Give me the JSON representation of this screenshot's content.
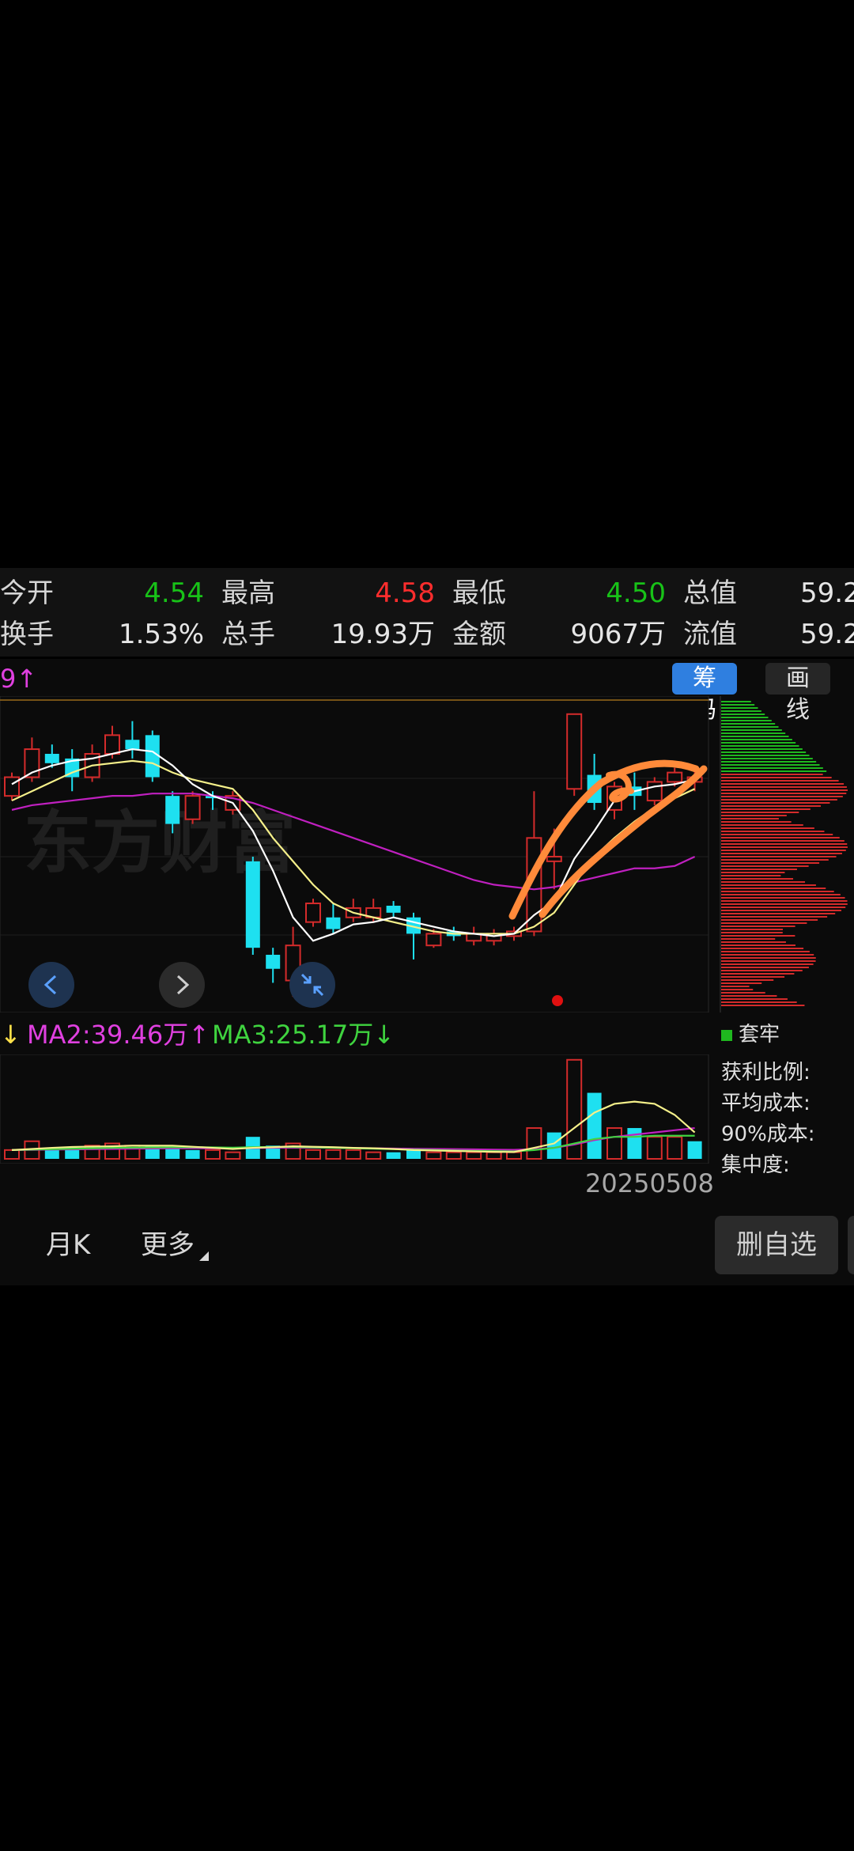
{
  "stats": {
    "row1": [
      {
        "label": "今开",
        "value": "4.54",
        "color": "green"
      },
      {
        "label": "最高",
        "value": "4.58",
        "color": "red"
      },
      {
        "label": "最低",
        "value": "4.50",
        "color": "green"
      },
      {
        "label": "总值",
        "value": "59.2"
      }
    ],
    "row2": [
      {
        "label": "换手",
        "value": "1.53%"
      },
      {
        "label": "总手",
        "value": "19.93万"
      },
      {
        "label": "金额",
        "value": "9067万"
      },
      {
        "label": "流值",
        "value": "59.2"
      }
    ]
  },
  "toolbar": {
    "ma_partial": "9↑",
    "chips_button": "筹码",
    "draw_button": "画线"
  },
  "watermark": "东方财富",
  "ma_legend": {
    "ma1_arrow": "↓",
    "ma2": "MA2:39.46万↑",
    "ma3": "MA3:25.17万↓"
  },
  "chip_panel": {
    "legend": "套牢",
    "profit_ratio": "获利比例:",
    "avg_cost": "平均成本:",
    "cost90": "90%成本:",
    "concentration": "集中度:"
  },
  "date": "20250508",
  "bottom": {
    "monthk": "月K",
    "more": "更多",
    "remove_watchlist": "删自选"
  },
  "colors": {
    "up": "#d42b2b",
    "down": "#1ee0f0",
    "ma_white": "#ffffff",
    "ma_yellow": "#f5f08a",
    "ma_magenta": "#c020c0",
    "annotation": "#ff8a3a"
  },
  "chart_data": {
    "type": "candlestick",
    "candles": [
      {
        "o": 4.2,
        "c": 4.28,
        "h": 4.3,
        "l": 4.18
      },
      {
        "o": 4.28,
        "c": 4.4,
        "h": 4.45,
        "l": 4.26
      },
      {
        "o": 4.38,
        "c": 4.34,
        "h": 4.42,
        "l": 4.32
      },
      {
        "o": 4.36,
        "c": 4.28,
        "h": 4.4,
        "l": 4.22
      },
      {
        "o": 4.28,
        "c": 4.38,
        "h": 4.42,
        "l": 4.26
      },
      {
        "o": 4.38,
        "c": 4.46,
        "h": 4.5,
        "l": 4.36
      },
      {
        "o": 4.44,
        "c": 4.4,
        "h": 4.52,
        "l": 4.36
      },
      {
        "o": 4.46,
        "c": 4.28,
        "h": 4.48,
        "l": 4.26
      },
      {
        "o": 4.2,
        "c": 4.08,
        "h": 4.22,
        "l": 4.04
      },
      {
        "o": 4.1,
        "c": 4.2,
        "h": 4.22,
        "l": 4.08
      },
      {
        "o": 4.2,
        "c": 4.19,
        "h": 4.22,
        "l": 4.14
      },
      {
        "o": 4.14,
        "c": 4.2,
        "h": 4.22,
        "l": 4.12
      },
      {
        "o": 3.92,
        "c": 3.55,
        "h": 3.94,
        "l": 3.52
      },
      {
        "o": 3.52,
        "c": 3.46,
        "h": 3.55,
        "l": 3.4
      },
      {
        "o": 3.41,
        "c": 3.56,
        "h": 3.64,
        "l": 3.34
      },
      {
        "o": 3.66,
        "c": 3.74,
        "h": 3.76,
        "l": 3.64
      },
      {
        "o": 3.68,
        "c": 3.63,
        "h": 3.74,
        "l": 3.61
      },
      {
        "o": 3.68,
        "c": 3.72,
        "h": 3.76,
        "l": 3.66
      },
      {
        "o": 3.68,
        "c": 3.72,
        "h": 3.76,
        "l": 3.66
      },
      {
        "o": 3.73,
        "c": 3.7,
        "h": 3.75,
        "l": 3.68
      },
      {
        "o": 3.68,
        "c": 3.61,
        "h": 3.7,
        "l": 3.5
      },
      {
        "o": 3.56,
        "c": 3.61,
        "h": 3.63,
        "l": 3.55
      },
      {
        "o": 3.62,
        "c": 3.6,
        "h": 3.64,
        "l": 3.58
      },
      {
        "o": 3.58,
        "c": 3.61,
        "h": 3.64,
        "l": 3.56
      },
      {
        "o": 3.58,
        "c": 3.61,
        "h": 3.63,
        "l": 3.56
      },
      {
        "o": 3.6,
        "c": 3.62,
        "h": 3.64,
        "l": 3.58
      },
      {
        "o": 3.62,
        "c": 4.02,
        "h": 4.22,
        "l": 3.6
      },
      {
        "o": 3.92,
        "c": 3.94,
        "h": 4.06,
        "l": 3.8
      },
      {
        "o": 4.23,
        "c": 4.55,
        "h": 4.55,
        "l": 4.2
      },
      {
        "o": 4.29,
        "c": 4.17,
        "h": 4.38,
        "l": 4.14
      },
      {
        "o": 4.14,
        "c": 4.24,
        "h": 4.26,
        "l": 4.1
      },
      {
        "o": 4.24,
        "c": 4.2,
        "h": 4.3,
        "l": 4.14
      },
      {
        "o": 4.18,
        "c": 4.26,
        "h": 4.28,
        "l": 4.16
      },
      {
        "o": 4.26,
        "c": 4.3,
        "h": 4.32,
        "l": 4.24
      },
      {
        "o": 4.26,
        "c": 4.28,
        "h": 4.32,
        "l": 4.22
      }
    ],
    "volume": [
      4,
      8,
      5,
      5,
      6,
      7,
      6,
      6,
      6,
      4,
      4,
      3,
      10,
      6,
      7,
      4,
      4,
      4,
      3,
      3,
      4,
      3,
      3,
      3,
      3,
      3,
      14,
      12,
      45,
      30,
      14,
      14,
      10,
      10,
      8
    ],
    "volume_up": [
      true,
      true,
      false,
      false,
      true,
      true,
      true,
      false,
      false,
      false,
      true,
      true,
      false,
      false,
      true,
      true,
      true,
      true,
      true,
      false,
      false,
      true,
      true,
      true,
      true,
      true,
      true,
      false,
      true,
      false,
      true,
      false,
      true,
      true,
      false
    ],
    "ma_white": [
      4.25,
      4.3,
      4.33,
      4.35,
      4.36,
      4.38,
      4.4,
      4.39,
      4.33,
      4.25,
      4.2,
      4.17,
      4.05,
      3.88,
      3.68,
      3.58,
      3.61,
      3.65,
      3.66,
      3.68,
      3.66,
      3.64,
      3.62,
      3.61,
      3.6,
      3.61,
      3.69,
      3.75,
      3.93,
      4.05,
      4.18,
      4.22,
      4.24,
      4.25,
      4.27
    ],
    "ma_yellow": [
      4.18,
      4.22,
      4.26,
      4.3,
      4.33,
      4.34,
      4.35,
      4.34,
      4.3,
      4.27,
      4.25,
      4.23,
      4.14,
      4.02,
      3.92,
      3.82,
      3.74,
      3.7,
      3.68,
      3.66,
      3.64,
      3.62,
      3.61,
      3.61,
      3.61,
      3.61,
      3.64,
      3.7,
      3.82,
      3.94,
      4.02,
      4.09,
      4.15,
      4.19,
      4.23
    ],
    "ma_magenta": [
      4.14,
      4.16,
      4.17,
      4.18,
      4.19,
      4.2,
      4.2,
      4.21,
      4.21,
      4.21,
      4.2,
      4.19,
      4.17,
      4.14,
      4.11,
      4.08,
      4.05,
      4.02,
      3.99,
      3.96,
      3.93,
      3.9,
      3.87,
      3.84,
      3.82,
      3.81,
      3.8,
      3.81,
      3.83,
      3.85,
      3.87,
      3.89,
      3.89,
      3.9,
      3.94
    ],
    "vol_ma_yellow": [
      4,
      4.5,
      5,
      5.4,
      5.6,
      5.7,
      6,
      6,
      6,
      5.5,
      5,
      4.5,
      5,
      5.3,
      5.7,
      5.5,
      5.3,
      5,
      4.8,
      4.5,
      4,
      3.8,
      3.6,
      3.4,
      3.2,
      3.1,
      5,
      7,
      14,
      21,
      25,
      26,
      25,
      20,
      12
    ],
    "vol_ma_green": [
      4,
      4.2,
      4.4,
      4.6,
      4.8,
      5,
      5.1,
      5.2,
      5.3,
      5.3,
      5.2,
      5.1,
      5.3,
      5.4,
      5.4,
      5.2,
      5.0,
      4.8,
      4.6,
      4.4,
      4.2,
      4.0,
      3.8,
      3.6,
      3.5,
      3.4,
      4,
      5,
      7,
      9,
      10,
      10,
      10.5,
      10.5,
      10.5
    ],
    "vol_ma_magenta": [
      4,
      4.1,
      4.2,
      4.3,
      4.4,
      4.5,
      4.6,
      4.7,
      4.8,
      4.8,
      4.8,
      4.8,
      4.9,
      5,
      5,
      5,
      5,
      4.9,
      4.8,
      4.7,
      4.6,
      4.5,
      4.4,
      4.3,
      4.2,
      4.1,
      4.4,
      5,
      6.5,
      8.5,
      10,
      11,
      12,
      13,
      14
    ]
  }
}
